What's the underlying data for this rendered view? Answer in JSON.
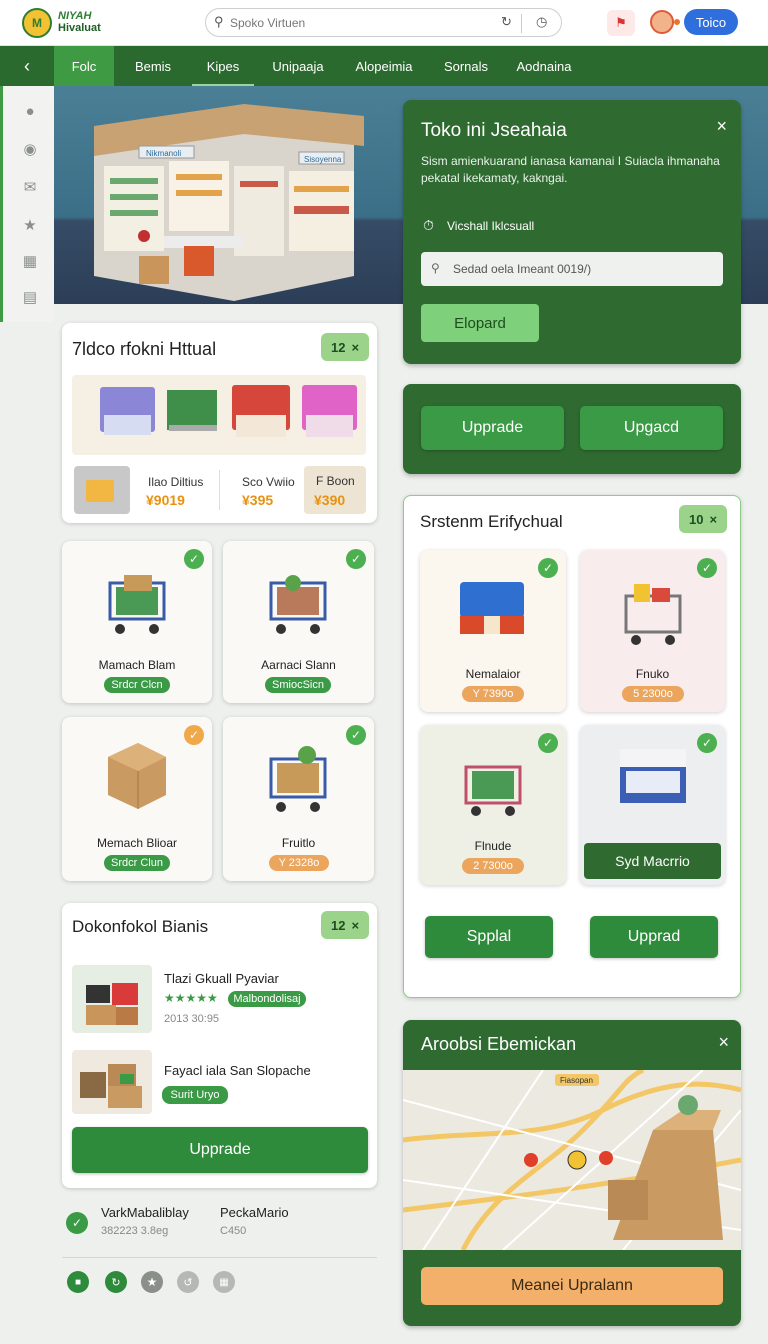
{
  "header": {
    "logo_mark": "M",
    "logo_line1": "NIYAH",
    "logo_line2": "Hivaluat",
    "search_placeholder": "Spoko Virtuen",
    "user_button": "Toico"
  },
  "nav": {
    "tabs": [
      "Folc",
      "Bemis",
      "Kipes",
      "Unipaaja",
      "Alopeimia",
      "Sornals",
      "Aodnaina"
    ]
  },
  "hero": {
    "sign_left": "Nikmanoli",
    "sign_right": "Sisoyenna"
  },
  "popup": {
    "title": "Toko ini Jseahaia",
    "desc_line1": "Sism amienkuarand ianasa kamanai I Suiacla ihmanaha",
    "desc_line2": "pekatal ikekamaty, kakngai.",
    "section_label": "Vicshall Iklcsuall",
    "input_placeholder": "Sedad oela Imeant 0019/)",
    "button": "Elopard"
  },
  "upgrade_panel": {
    "btn1": "Upprade",
    "btn2": "Upgacd"
  },
  "store_card": {
    "title": "7ldco rfokni Httual",
    "badge": "12",
    "stat1_label": "Ilao Diltius",
    "stat1_value": "¥9019",
    "stat2_label": "Sco Vwiio",
    "stat2_value": "¥395",
    "stat3_label": "F Boon",
    "stat3_value": "¥390"
  },
  "products": [
    {
      "name": "Mamach Blam",
      "tag": "Srdcr Clcn",
      "tag_color": "#3a9a45",
      "check_color": "#4caf50"
    },
    {
      "name": "Aarnaci Slann",
      "tag": "SmiocSicn",
      "tag_color": "#3a9a45",
      "check_color": "#4caf50"
    },
    {
      "name": "Memach Blioar",
      "tag": "Srdcr Clun",
      "tag_color": "#3a9a45",
      "check_color": "#f0a94a"
    },
    {
      "name": "Fruitlo",
      "tag": "Y 2328o",
      "tag_color": "#eba55c",
      "check_color": "#4caf50"
    }
  ],
  "system_card": {
    "title": "Srstenm Erifychual",
    "badge": "10",
    "items": [
      {
        "name": "Nemalaior",
        "price": "Y 7390o"
      },
      {
        "name": "Fnuko",
        "price": "5 2300o"
      },
      {
        "name": "Flnude",
        "price": "2 7300o"
      },
      {
        "name": "Syd Macrrio"
      }
    ],
    "btn1": "Spplal",
    "btn2": "Upprad"
  },
  "list_card": {
    "title": "Dokonfokol Bianis",
    "badge": "12",
    "item1_title": "Tlazi Gkuall Pyaviar",
    "item1_stars": "★★★★★",
    "item1_tag": "Malbondolisaj",
    "item1_sub": "2013 30:95",
    "item2_title": "Fayacl iala San Slopache",
    "item2_tag": "Surit Uryo",
    "button": "Upprade"
  },
  "footer": {
    "col1_title": "VarkMabaliblay",
    "col1_sub": "382223 3.8eg",
    "col2_title": "PeckaMario",
    "col2_sub": "C450"
  },
  "delivery": {
    "title": "Aroobsi Ebemickan",
    "map_label": "Fiasopan",
    "button": "Meanei Upralann"
  },
  "colors": {
    "brand_green": "#2b6a2e",
    "accent_green": "#3f9b43",
    "light_green": "#9bd38a",
    "orange": "#f2b06a",
    "blue": "#2f6fdd"
  }
}
